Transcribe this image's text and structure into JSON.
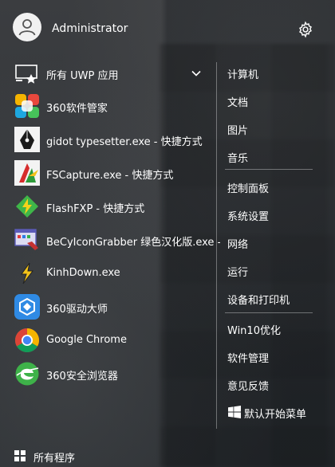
{
  "header": {
    "user_name": "Administrator"
  },
  "left_panel": {
    "uwp_label": "所有 UWP 应用",
    "apps": [
      {
        "label": "360软件管家",
        "icon": "360-software-manager-icon"
      },
      {
        "label": "gidot typesetter.exe - 快捷方式",
        "icon": "pen-nib-icon"
      },
      {
        "label": "FSCapture.exe - 快捷方式",
        "icon": "fscapture-icon"
      },
      {
        "label": "FlashFXP - 快捷方式",
        "icon": "flashfxp-icon"
      },
      {
        "label": "BeCyIconGrabber 绿色汉化版.exe - 快",
        "icon": "icon-grabber-icon"
      },
      {
        "label": "KinhDown.exe",
        "icon": "kinhdown-icon"
      },
      {
        "label": "360驱动大师",
        "icon": "360-driver-master-icon"
      },
      {
        "label": "Google Chrome",
        "icon": "chrome-icon"
      },
      {
        "label": "360安全浏览器",
        "icon": "360-browser-icon"
      }
    ],
    "all_programs_label": "所有程序"
  },
  "right_panel": {
    "group1": [
      "计算机",
      "文档",
      "图片",
      "音乐"
    ],
    "group2": [
      "控制面板",
      "系统设置",
      "网络",
      "运行",
      "设备和打印机"
    ],
    "group3": [
      "Win10优化",
      "软件管理",
      "意见反馈",
      "默认开始菜单"
    ]
  },
  "colors": {
    "accent_blue": "#2f8ae4",
    "panel_bg": "#3a3c40",
    "text": "#ffffff"
  }
}
